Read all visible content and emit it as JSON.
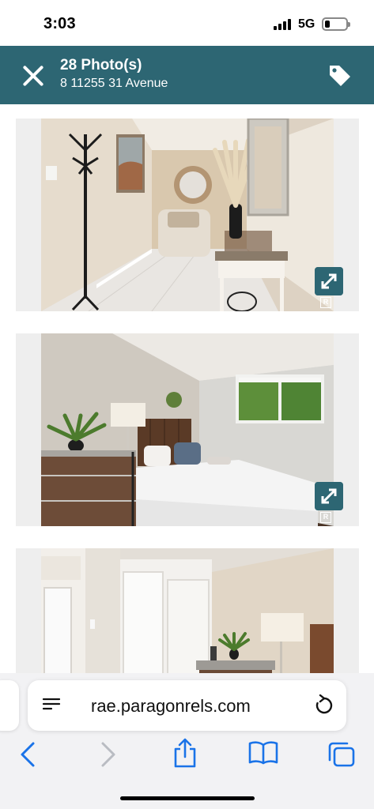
{
  "status_bar": {
    "time": "3:03",
    "network": "5G",
    "battery_level": 0.25
  },
  "header": {
    "title": "28 Photo(s)",
    "subtitle": "8 11255 31 Avenue",
    "close_icon": "close-icon",
    "tag_icon": "tag-icon"
  },
  "photos": [
    {
      "scene": "entry-hallway",
      "watermark": "R"
    },
    {
      "scene": "bedroom",
      "watermark": "R"
    },
    {
      "scene": "bedroom-closet",
      "watermark": ""
    }
  ],
  "browser": {
    "url": "rae.paragonrels.com",
    "icons": [
      "reader-icon",
      "reload-icon",
      "back-icon",
      "forward-icon",
      "share-icon",
      "bookmarks-icon",
      "tabs-icon"
    ]
  },
  "colors": {
    "header": "#2d6673",
    "accent": "#2d6673",
    "ios_blue": "#1a73e8"
  }
}
